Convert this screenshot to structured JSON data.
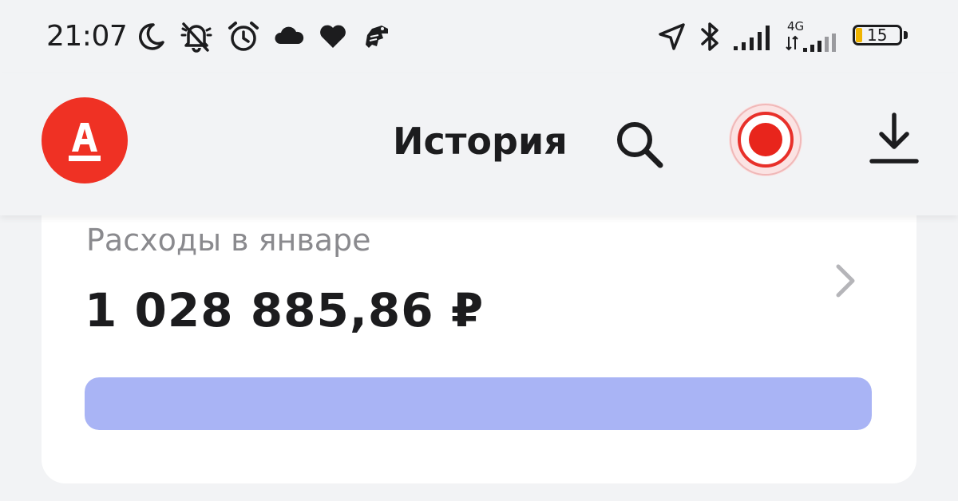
{
  "status_bar": {
    "time": "21:07",
    "network_type": "4G",
    "battery_level": "15",
    "battery_fraction": 0.15,
    "left_icons": [
      "moon-icon",
      "muted-bell-icon",
      "alarm-icon",
      "cloud-icon",
      "heart-icon",
      "dino-icon"
    ],
    "right_icons": [
      "location-arrow-icon",
      "bluetooth-icon",
      "signal-icon",
      "signal-4g-icon",
      "battery-icon"
    ]
  },
  "header": {
    "title": "История",
    "logo_icon": "alfa-bank-logo-icon",
    "search_icon": "search-icon",
    "record_icon": "record-icon",
    "download_icon": "download-icon"
  },
  "card": {
    "label": "Расходы в январе",
    "amount": "1 028 885,86 ₽",
    "chevron_icon": "chevron-right-icon",
    "bar_fill_fraction": 1.0
  },
  "colors": {
    "brand_red": "#ef3124",
    "spend_bar": "#a9b4f5",
    "battery_low": "#f0b400",
    "background": "#f2f3f5"
  }
}
